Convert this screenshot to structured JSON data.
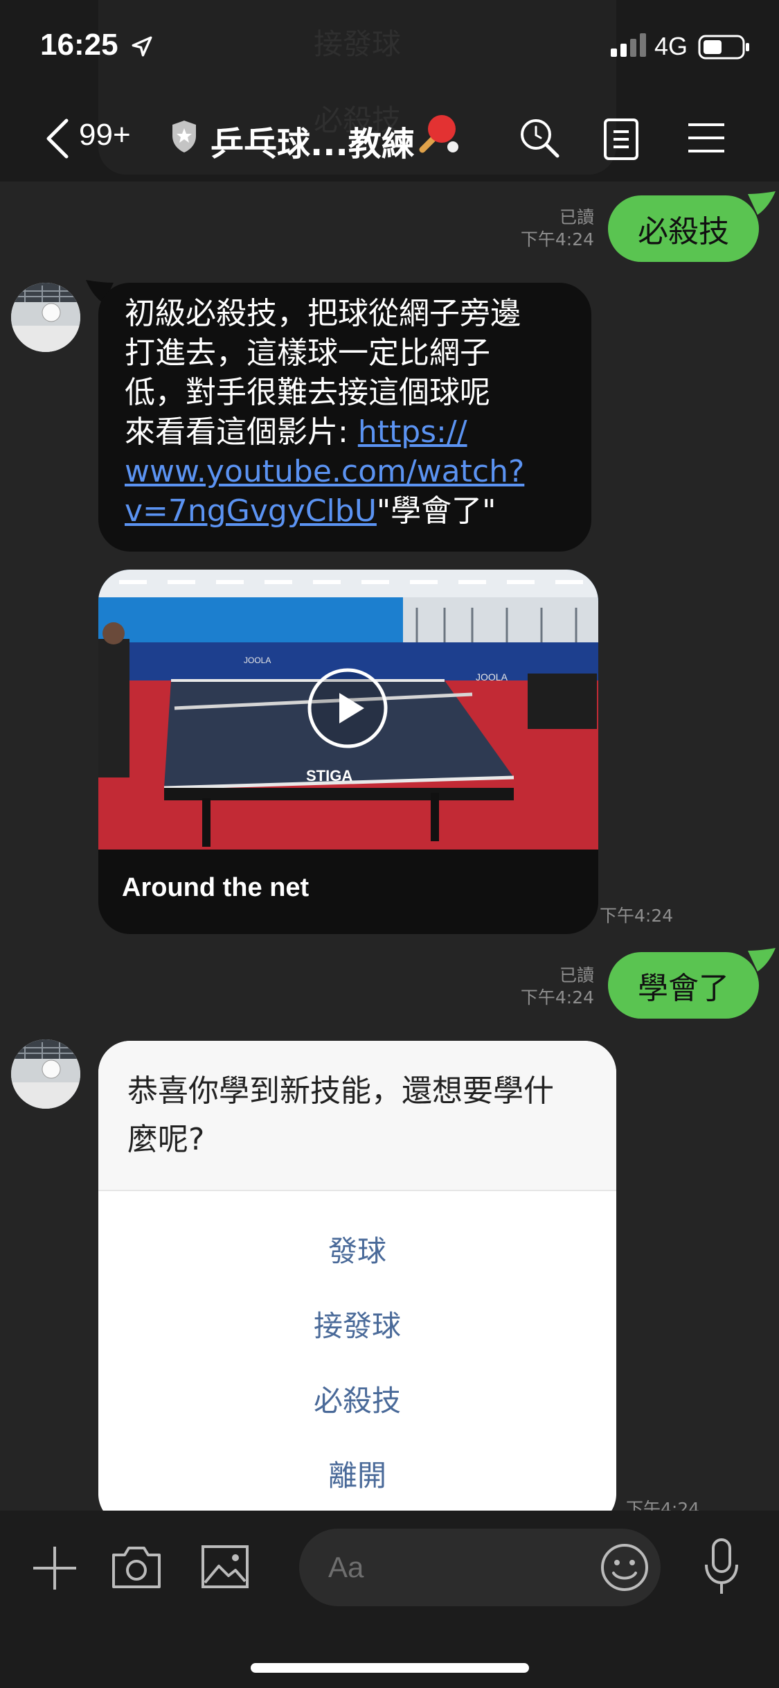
{
  "status_bar": {
    "time": "16:25",
    "network": "4G"
  },
  "header": {
    "back_count": "99+",
    "title": "乒乓球...教練",
    "ghost_items": [
      "接發球",
      "必殺技"
    ]
  },
  "messages": [
    {
      "kind": "sent",
      "read_label": "已讀",
      "time": "下午4:24",
      "text": "必殺技"
    },
    {
      "kind": "received",
      "text_lines": [
        "初級必殺技，把球從網子旁邊",
        "打進去，這樣球一定比網子",
        "低，對手很難去接這個球呢",
        "來看看這個影片: "
      ],
      "link_line1": "https://",
      "link_line2": "www.youtube.com/watch?",
      "link_line3": "v=7ngGvgyClbU",
      "suffix": "\"學會了\""
    },
    {
      "kind": "video",
      "caption": "Around the net",
      "time": "下午4:24"
    },
    {
      "kind": "sent",
      "read_label": "已讀",
      "time": "下午4:24",
      "text": "學會了"
    },
    {
      "kind": "quick_reply",
      "question": "恭喜你學到新技能，還想要學什麼呢?",
      "options": [
        "發球",
        "接發球",
        "必殺技",
        "離開"
      ],
      "time": "下午4:24"
    }
  ],
  "input": {
    "placeholder": "Aa"
  },
  "colors": {
    "sent_bubble": "#5ac451",
    "received_bubble": "#0f0f0f",
    "link": "#5b93f2",
    "option_text": "#4a6a99"
  }
}
